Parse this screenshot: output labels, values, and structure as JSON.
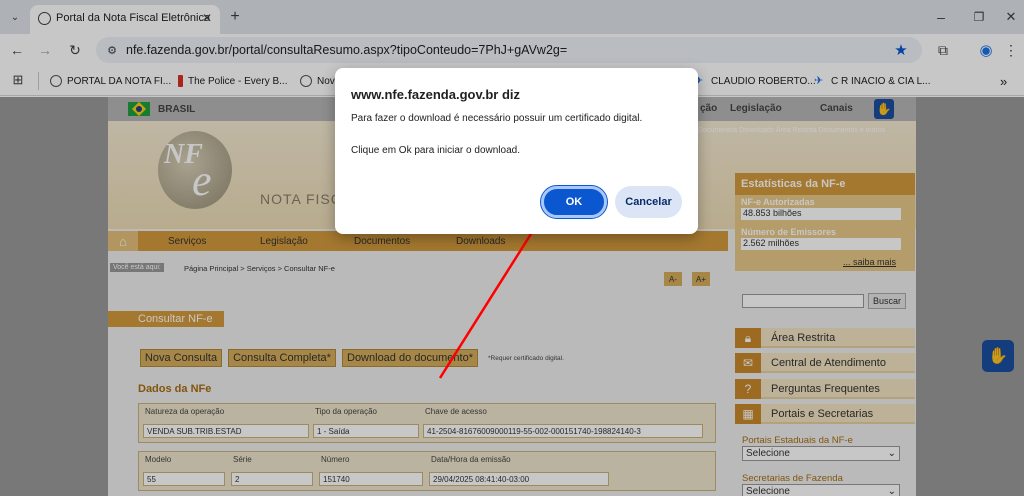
{
  "browser": {
    "tab_title": "Portal da Nota Fiscal Eletrônica",
    "url": "nfe.fazenda.gov.br/portal/consultaResumo.aspx?tipoConteudo=7PhJ+gAVw2g=",
    "bookmarks": [
      {
        "label": "PORTAL DA NOTA FI...",
        "icon": "globe-icon"
      },
      {
        "label": "The Police - Every B...",
        "icon": "bookmark-red-icon"
      },
      {
        "label": "Nov",
        "icon": "globe-icon"
      },
      {
        "label": "CLAUDIO ROBERTO...",
        "icon": "bookmark-blue-icon"
      },
      {
        "label": "C R INACIO & CIA L...",
        "icon": "bookmark-blue-icon"
      }
    ],
    "more_bookmarks": "»"
  },
  "site": {
    "top_bar": {
      "country": "BRASIL",
      "links": [
        "ção",
        "Legislação",
        "Canais"
      ]
    },
    "sublinks": "Documentos   Downloads   Área Restrita   Documentos e outros",
    "logo_text": "NOTA FISCA",
    "nav": [
      "Serviços",
      "Legislação",
      "Documentos",
      "Downloads"
    ],
    "breadcrumb_tag": "Você está aqui:",
    "breadcrumb": "Página Principal > Serviços > Consultar NF-e",
    "font_minus": "A-",
    "font_plus": "A+",
    "section_title": "Consultar NF-e",
    "buttons": [
      "Nova Consulta",
      "Consulta Completa*",
      "Download do documento*"
    ],
    "cert_note": "*Requer certificado digital.",
    "dados_title": "Dados da NFe",
    "fields_row1": {
      "labels": [
        "Natureza da operação",
        "Tipo da operação",
        "Chave de acesso"
      ],
      "values": [
        "VENDA SUB.TRIB.ESTAD",
        "1 - Saída",
        "41-2504-81676009000119-55-002-000151740-198824140-3"
      ]
    },
    "fields_row2": {
      "labels": [
        "Modelo",
        "Série",
        "Número",
        "Data/Hora da emissão"
      ],
      "values": [
        "55",
        "2",
        "151740",
        "29/04/2025 08:41:40-03:00"
      ]
    },
    "stats": {
      "title": "Estatísticas da NF-e",
      "label1": "NF-e Autorizadas",
      "value1": "48.853 bilhões",
      "label2": "Número de Emissores",
      "value2": "2.562 milhões",
      "more": "... saiba mais"
    },
    "search_button": "Buscar",
    "side_menu": [
      "Área Restrita",
      "Central de Atendimento",
      "Perguntas Frequentes",
      "Portais e Secretarias"
    ],
    "portais_label": "Portais Estaduais da NF-e",
    "portais_select": "Selecione",
    "secretarias_label": "Secretarias de Fazenda",
    "secretarias_select": "Selecione"
  },
  "dialog": {
    "title": "www.nfe.fazenda.gov.br diz",
    "message1": "Para fazer o download é necessário possuir um certificado digital.",
    "message2": "Clique em Ok para iniciar o download.",
    "ok_label": "OK",
    "cancel_label": "Cancelar"
  },
  "colors": {
    "accent_blue": "#0b57d0",
    "site_orange": "#d39a3d",
    "annotation_arrow": "#ff0000"
  }
}
